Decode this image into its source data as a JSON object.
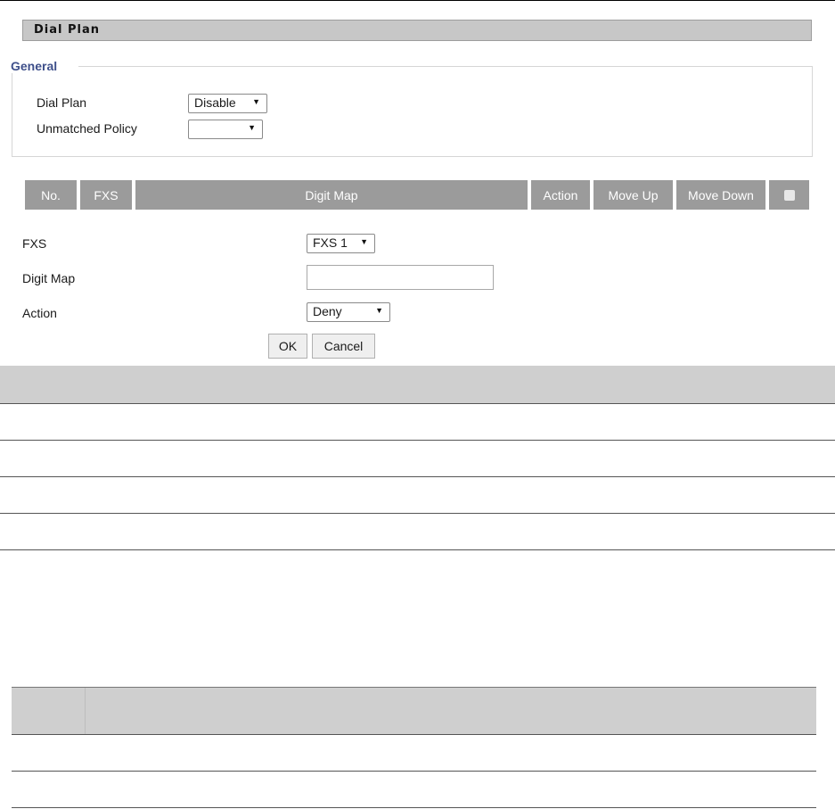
{
  "section_title": "Dial Plan",
  "general": {
    "legend": "General",
    "dial_plan_label": "Dial Plan",
    "dial_plan_value": "Disable",
    "unmatched_policy_label": "Unmatched Policy",
    "unmatched_policy_value": ""
  },
  "table_header": {
    "no": "No.",
    "fxs": "FXS",
    "digit_map": "Digit Map",
    "action": "Action",
    "move_up": "Move Up",
    "move_down": "Move Down"
  },
  "form": {
    "fxs_label": "FXS",
    "fxs_value": "FXS 1",
    "digit_map_label": "Digit Map",
    "digit_map_value": "",
    "action_label": "Action",
    "action_value": "Deny",
    "ok_label": "OK",
    "cancel_label": "Cancel"
  },
  "colors": {
    "header_bg": "#9b9b9b",
    "legend_text": "#3e4f8a",
    "title_bar_bg": "#c7c7c7"
  }
}
